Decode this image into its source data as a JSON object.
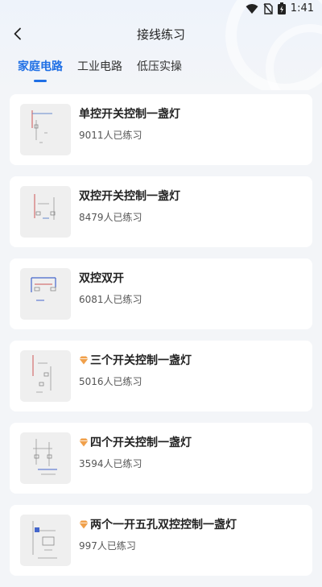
{
  "status_bar": {
    "time": "1:41",
    "icons": [
      "wifi-icon",
      "no-sim-icon",
      "battery-charging-icon"
    ]
  },
  "header": {
    "title": "接线练习",
    "back_icon": "chevron-left-icon"
  },
  "tabs": [
    {
      "label": "家庭电路",
      "active": true
    },
    {
      "label": "工业电路",
      "active": false
    },
    {
      "label": "低压实操",
      "active": false
    }
  ],
  "colors": {
    "accent": "#1f6fe5",
    "vip_badge": "#f0a04b"
  },
  "items": [
    {
      "title": "单控开关控制一盏灯",
      "practice_count": "9011人已练习",
      "vip": false
    },
    {
      "title": "双控开关控制一盏灯",
      "practice_count": "8479人已练习",
      "vip": false
    },
    {
      "title": "双控双开",
      "practice_count": "6081人已练习",
      "vip": false
    },
    {
      "title": "三个开关控制一盏灯",
      "practice_count": "5016人已练习",
      "vip": true
    },
    {
      "title": "四个开关控制一盏灯",
      "practice_count": "3594人已练习",
      "vip": true
    },
    {
      "title": "两个一开五孔双控控制一盏灯",
      "practice_count": "997人已练习",
      "vip": true
    }
  ]
}
